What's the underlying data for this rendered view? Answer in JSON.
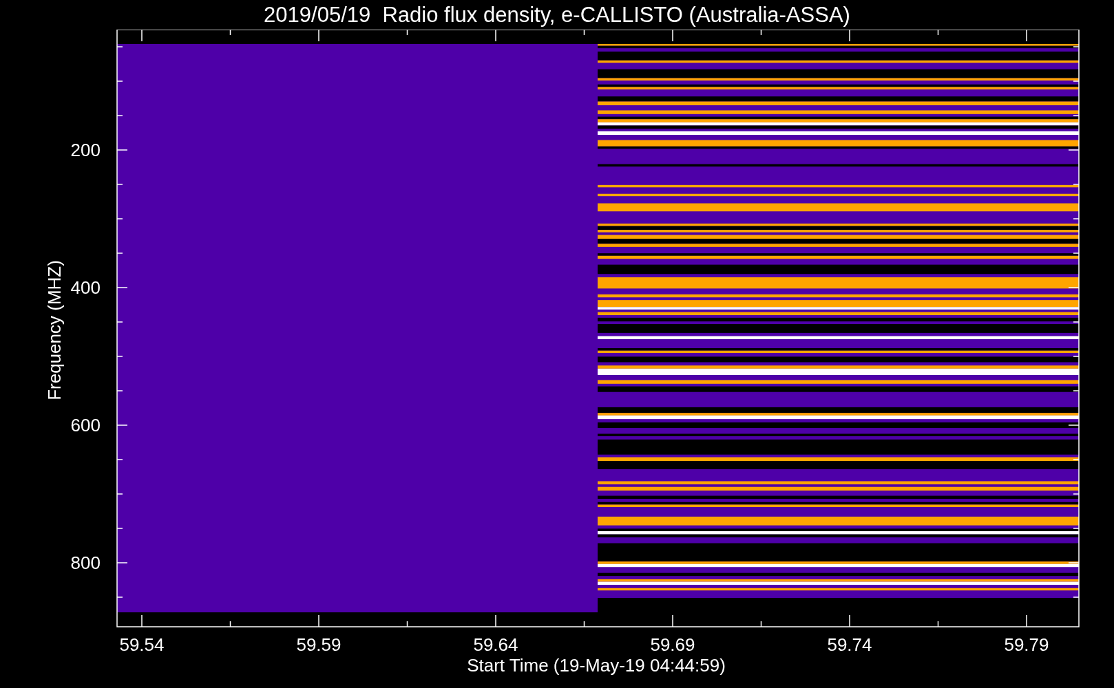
{
  "title": "2019/05/19  Radio flux density, e-CALLISTO (Australia-ASSA)",
  "y_axis": {
    "label": "Frequency (MHZ)",
    "ticks": [
      "200",
      "400",
      "600",
      "800"
    ]
  },
  "x_axis": {
    "label": "Start Time (19-May-19 04:44:59)",
    "ticks": [
      "59.54",
      "59.59",
      "59.64",
      "59.69",
      "59.74",
      "59.79"
    ]
  }
}
